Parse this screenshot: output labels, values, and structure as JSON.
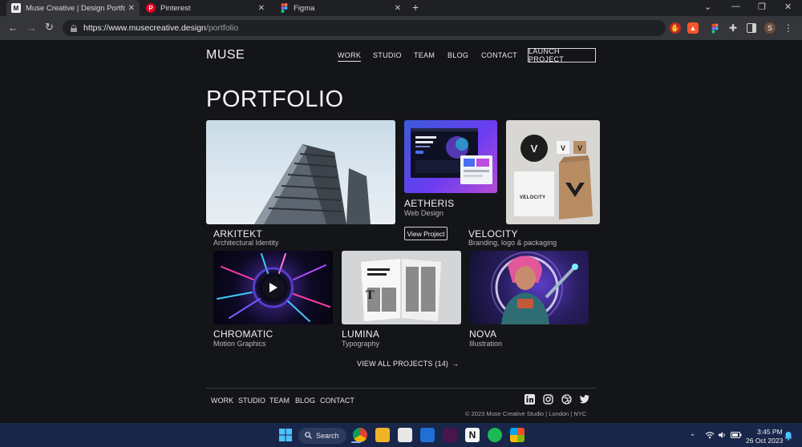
{
  "browser": {
    "tabs": [
      {
        "title": "Muse Creative | Design Portfolio",
        "favicon": "M",
        "active": true
      },
      {
        "title": "Pinterest",
        "favicon": "P",
        "active": false
      },
      {
        "title": "Figma",
        "favicon": "F",
        "active": false
      }
    ],
    "new_tab": "+",
    "url_host": "https://www.musecreative.design",
    "url_path": "/portfolio",
    "profile_initial": "S"
  },
  "site": {
    "logo": "MUSE",
    "nav": [
      "WORK",
      "STUDIO",
      "TEAM",
      "BLOG",
      "CONTACT"
    ],
    "launch_button": "LAUNCH PROJECT",
    "page_title": "PORTFOLIO",
    "projects": [
      {
        "name": "ARKITEKT",
        "category": "Architectural Identity"
      },
      {
        "name": "AETHERIS",
        "category": "Web Design"
      },
      {
        "name": "VELOCITY",
        "category": "Branding, logo & packaging"
      },
      {
        "name": "CHROMATIC",
        "category": "Motion Graphics"
      },
      {
        "name": "LUMINA",
        "category": "Typography"
      },
      {
        "name": "NOVA",
        "category": "Illustration"
      }
    ],
    "velocity_mark": "VELOCITY",
    "view_project_button": "View Project",
    "view_all_link": "VIEW ALL PROJECTS (14)",
    "view_all_arrow": "→",
    "footer": {
      "nav": [
        "WORK",
        "STUDIO",
        "TEAM",
        "BLOG",
        "CONTACT"
      ],
      "social_icons": [
        "linkedin-icon",
        "instagram-icon",
        "dribbble-icon",
        "twitter-icon"
      ],
      "copyright": "© 2023 Muse Creative Studio | London | NYC"
    }
  },
  "taskbar": {
    "search_label": "Search",
    "time": "3:45 PM",
    "date": "26 Oct 2023"
  },
  "colors": {
    "background": "#141518",
    "chrome": "#35363a",
    "taskbar": "#18264a",
    "accent_blue": "#3b5bdb"
  }
}
